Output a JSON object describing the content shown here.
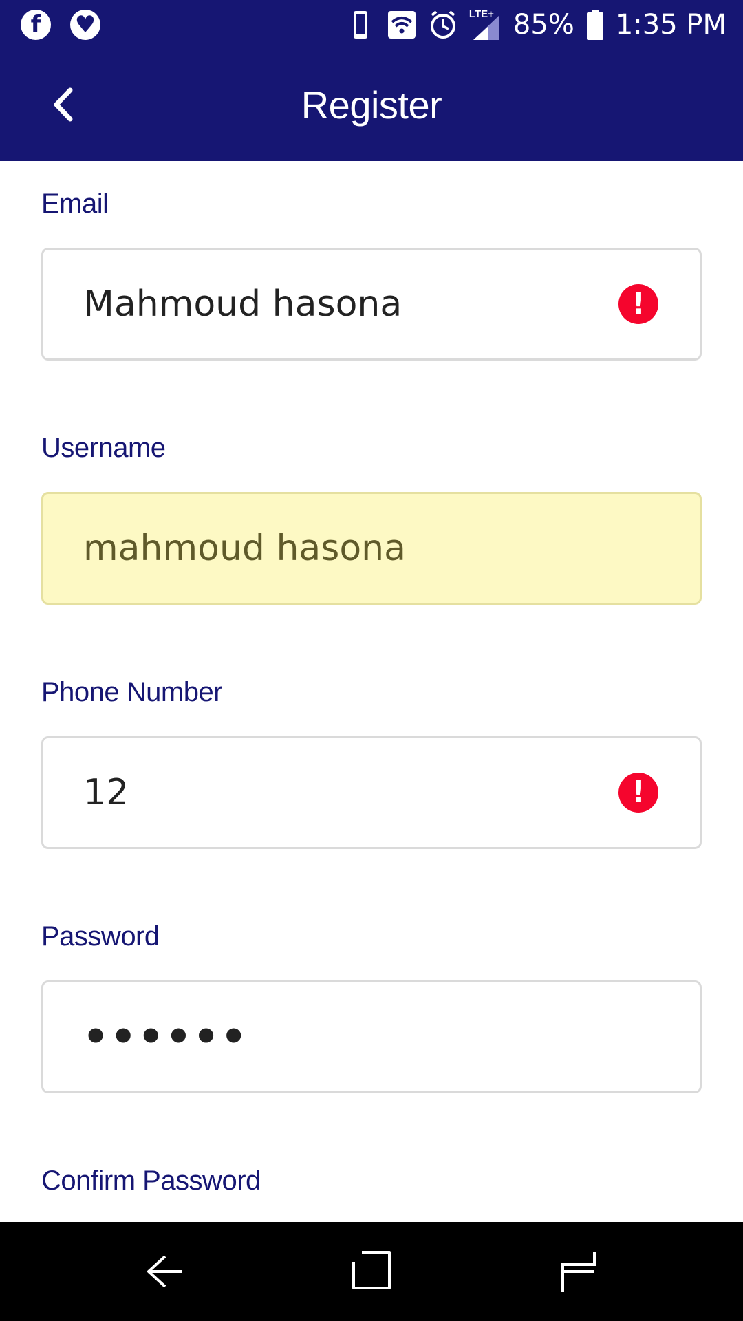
{
  "status_bar": {
    "battery": "85%",
    "time": "1:35 PM",
    "network": "LTE+",
    "icons": [
      "facebook-icon",
      "heart-app-icon",
      "phone-icon",
      "wifi-icon",
      "alarm-icon",
      "signal-icon",
      "battery-icon"
    ]
  },
  "app_bar": {
    "title": "Register",
    "back_icon": "chevron-left-icon"
  },
  "form": {
    "email": {
      "label": "Email",
      "value": "Mahmoud hasona",
      "error": true
    },
    "username": {
      "label": "Username",
      "value": "mahmoud hasona",
      "autofilled": true
    },
    "phone": {
      "label": "Phone Number",
      "value": "12",
      "error": true
    },
    "password": {
      "label": "Password",
      "value": "••••••"
    },
    "confirm_password": {
      "label": "Confirm Password"
    }
  },
  "colors": {
    "primary": "#161673",
    "error": "#f5052d",
    "autofill": "#fdf9c4"
  },
  "nav_bar": {
    "icons": [
      "back-nav-icon",
      "home-nav-icon",
      "recents-nav-icon"
    ]
  }
}
